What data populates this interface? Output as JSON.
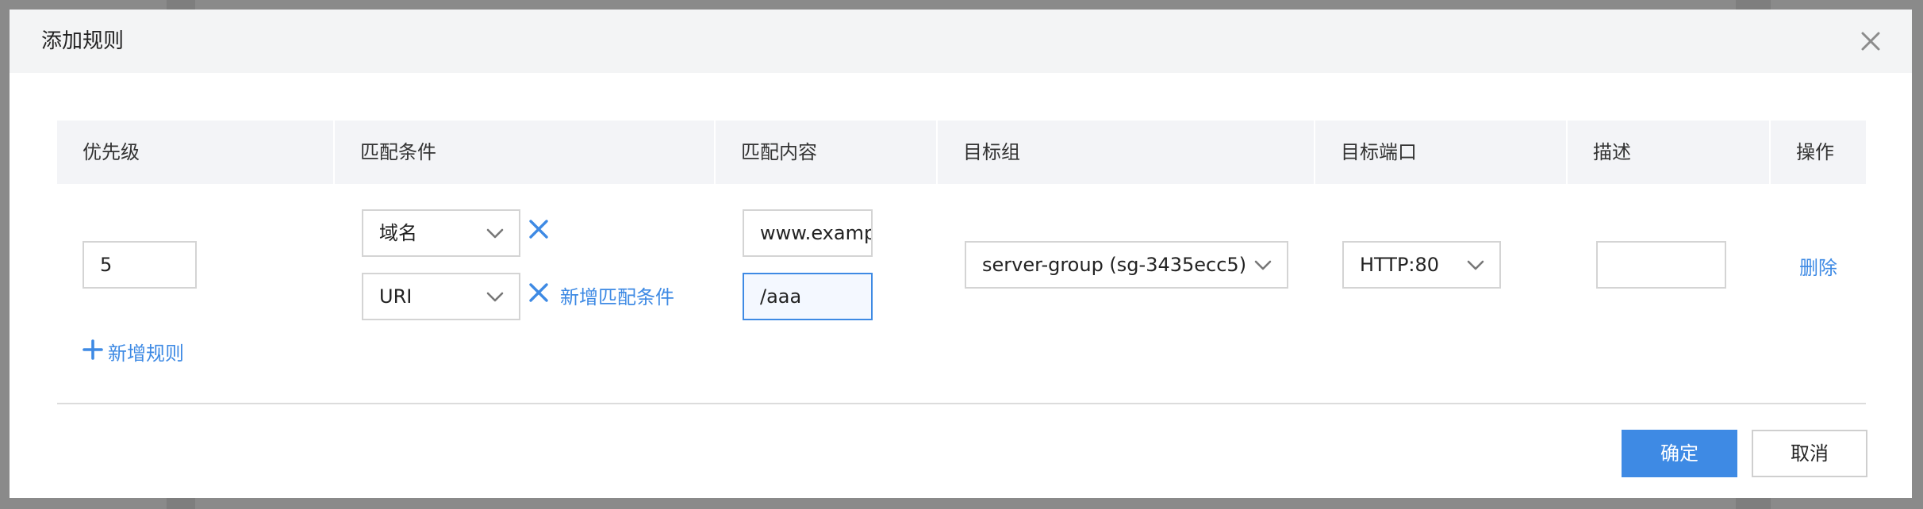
{
  "dialog": {
    "title": "添加规则",
    "close_label": "×"
  },
  "table": {
    "headers": [
      "优先级",
      "匹配条件",
      "匹配内容",
      "目标组",
      "目标端口",
      "描述",
      "操作"
    ],
    "rule": {
      "priority": "5",
      "conditions": [
        {
          "type": "域名",
          "value": "www.example.com",
          "remove_icon": "close-icon"
        },
        {
          "type": "URI",
          "value": "/aaa",
          "remove_icon": "close-icon"
        }
      ],
      "add_condition_label": "新增匹配条件",
      "target_group": "server-group (sg-3435ecc5)",
      "target_port": "HTTP:80",
      "description": "",
      "delete_label": "删除"
    },
    "add_rule_label": "新增规则"
  },
  "footer": {
    "confirm_label": "确定",
    "cancel_label": "取消"
  },
  "colors": {
    "accent": "#3e8ae4",
    "header_bg": "#f3f4f5",
    "table_head_bg": "#f3f4f7"
  }
}
